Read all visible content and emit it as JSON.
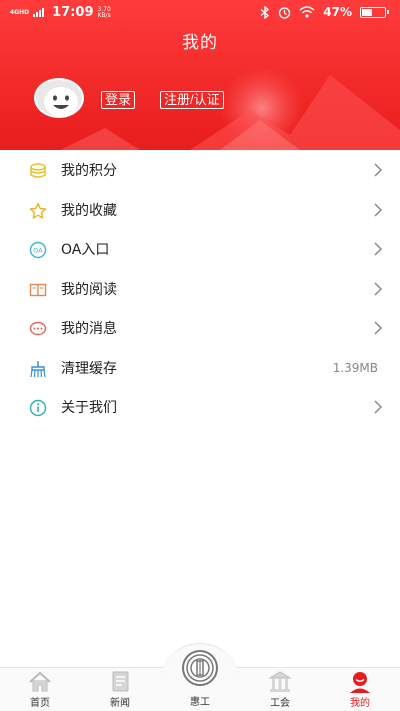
{
  "status_bar": {
    "network": "4GHD",
    "time": "17:09",
    "speed": "3.70",
    "speed_unit": "KB/s",
    "battery_percent": "47%",
    "battery_level": 0.47
  },
  "header": {
    "title": "我的",
    "login_label": "登录",
    "register_label": "注册/认证"
  },
  "menu": {
    "items": [
      {
        "label": "我的积分",
        "icon": "coins-icon"
      },
      {
        "label": "我的收藏",
        "icon": "star-icon"
      },
      {
        "label": "OA入口",
        "icon": "oa-icon"
      },
      {
        "label": "我的阅读",
        "icon": "book-icon"
      },
      {
        "label": "我的消息",
        "icon": "message-icon"
      },
      {
        "label": "清理缓存",
        "icon": "broom-icon",
        "value": "1.39MB"
      },
      {
        "label": "关于我们",
        "icon": "info-icon"
      }
    ]
  },
  "tabbar": {
    "tabs": [
      {
        "label": "首页",
        "icon": "home-icon"
      },
      {
        "label": "新闻",
        "icon": "news-icon"
      },
      {
        "label": "惠工",
        "icon": "union-logo-icon"
      },
      {
        "label": "工会",
        "icon": "building-icon"
      },
      {
        "label": "我的",
        "icon": "user-icon",
        "active": true
      }
    ]
  },
  "colors": {
    "brand_red": "#e81d1d",
    "active_tab": "#e51d1d"
  }
}
